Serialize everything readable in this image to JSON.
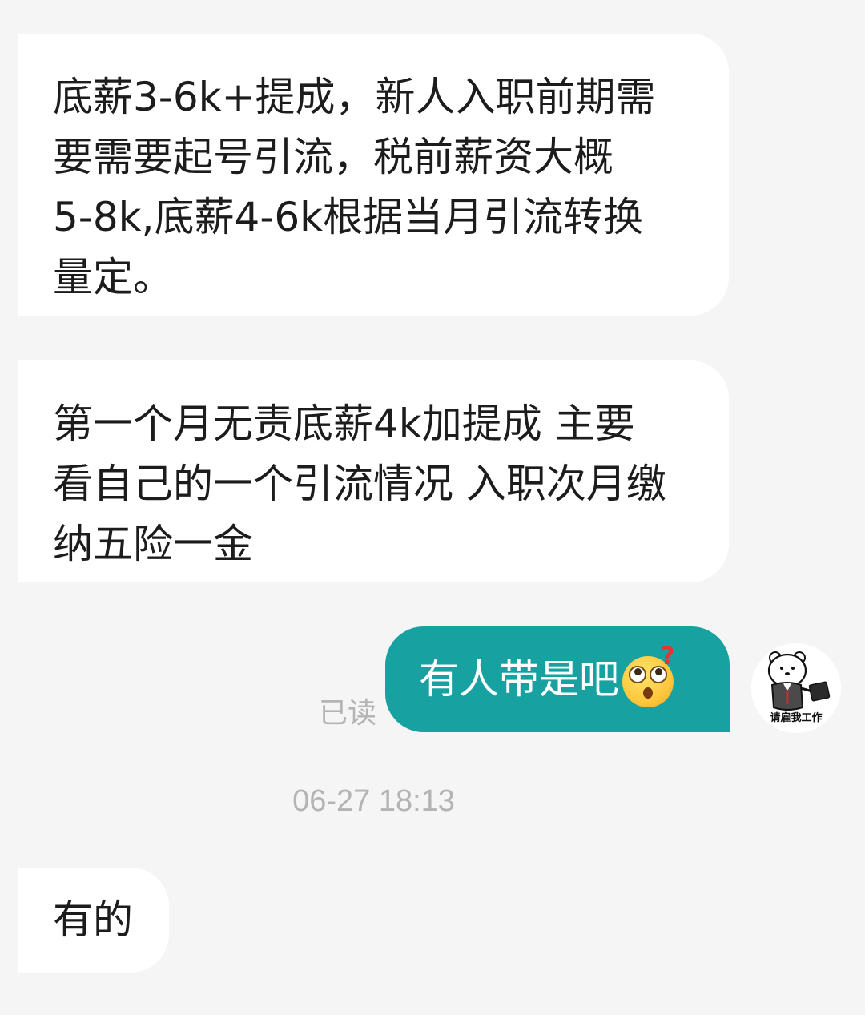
{
  "messages": [
    {
      "id": "msg-1",
      "direction": "incoming",
      "text": "底薪3-6k+提成，新人入职前期需\n要需要起号引流，税前薪资大概\n5-8k,底薪4-6k根据当月引流转换\n量定。"
    },
    {
      "id": "msg-2",
      "direction": "incoming",
      "text": "第一个月无责底薪4k加提成 主要\n看自己的一个引流情况 入职次月缴\n纳五险一金"
    },
    {
      "id": "msg-3",
      "direction": "outgoing",
      "text": "有人带是吧",
      "emoji": "face-with-rolling-eyes-question-emoji",
      "read_status": "已读"
    },
    {
      "id": "msg-4",
      "direction": "incoming",
      "text": "有的"
    }
  ],
  "timestamp": "06-27 18:13",
  "avatar": {
    "icon": "polar-bear-with-briefcase-avatar",
    "caption": "请雇我工作"
  },
  "colors": {
    "background": "#f5f5f5",
    "incoming_bubble": "#ffffff",
    "outgoing_bubble": "#17a2a1",
    "muted_text": "#b4b4b4"
  }
}
